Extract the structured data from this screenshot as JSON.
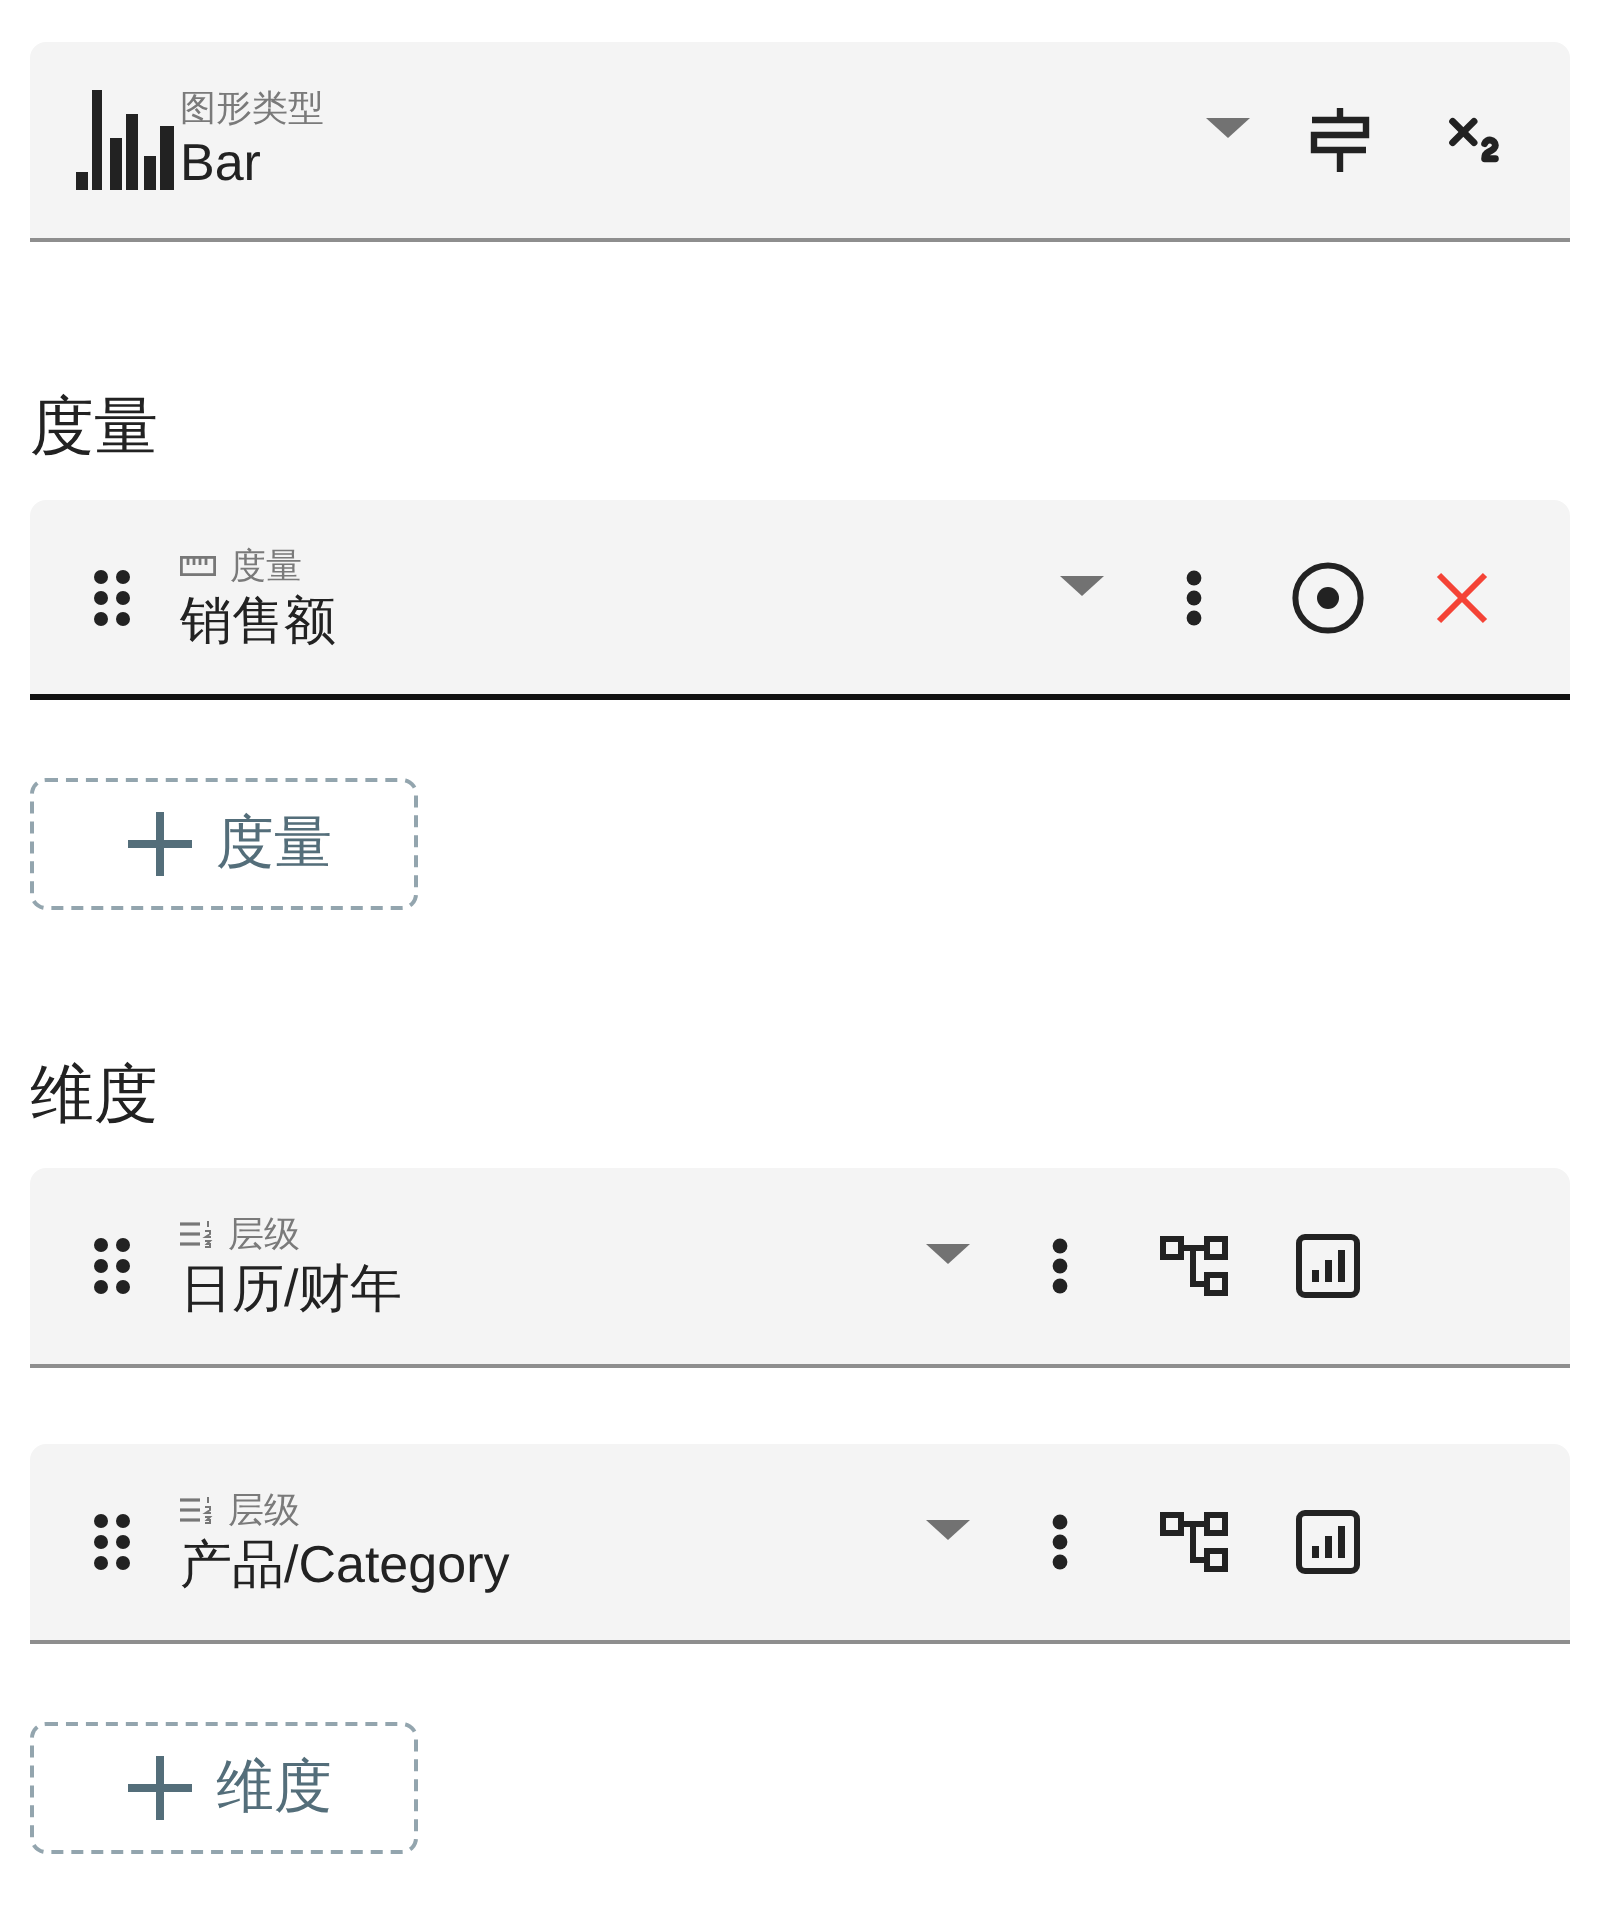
{
  "chart_type": {
    "label": "图形类型",
    "value": "Bar"
  },
  "sections": [
    {
      "heading": "度量",
      "fields": [
        {
          "kind": "measure",
          "label": "度量",
          "value": "销售额",
          "focused": true
        }
      ],
      "add_button": "度量"
    },
    {
      "heading": "维度",
      "fields": [
        {
          "kind": "hierarchy",
          "label": "层级",
          "value": "日历/财年",
          "focused": false
        },
        {
          "kind": "hierarchy",
          "label": "层级",
          "value": "产品/Category",
          "focused": false
        }
      ],
      "add_button": "维度"
    }
  ]
}
